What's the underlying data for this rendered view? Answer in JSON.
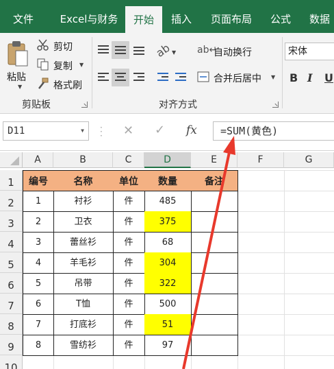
{
  "tabs": [
    "文件",
    "Excel与财务",
    "开始",
    "插入",
    "页面布局",
    "公式",
    "数据"
  ],
  "clipboard": {
    "paste_label": "粘贴",
    "cut_label": "剪切",
    "copy_label": "复制",
    "format_painter_label": "格式刷",
    "group_label": "剪贴板"
  },
  "alignment": {
    "wrap_text_label": "自动换行",
    "merge_center_label": "合并后居中",
    "group_label": "对齐方式"
  },
  "font": {
    "font_name": "宋体",
    "bold": "B",
    "italic": "I",
    "underline": "U"
  },
  "formula_bar": {
    "name_box": "D11",
    "cancel_icon": "✕",
    "enter_icon": "✓",
    "fx_label": "fx",
    "formula": "=SUM(黄色)"
  },
  "columns": [
    "A",
    "B",
    "C",
    "D",
    "E",
    "F",
    "G"
  ],
  "rows": [
    "1",
    "2",
    "3",
    "4",
    "5",
    "6",
    "7",
    "8",
    "9",
    "10"
  ],
  "table": {
    "headers": [
      "编号",
      "名称",
      "单位",
      "数量",
      "备注"
    ],
    "rows": [
      [
        "1",
        "衬衫",
        "件",
        "485",
        ""
      ],
      [
        "2",
        "卫衣",
        "件",
        "375",
        ""
      ],
      [
        "3",
        "蕾丝衫",
        "件",
        "68",
        ""
      ],
      [
        "4",
        "羊毛衫",
        "件",
        "304",
        ""
      ],
      [
        "5",
        "吊带",
        "件",
        "322",
        ""
      ],
      [
        "6",
        "T恤",
        "件",
        "500",
        ""
      ],
      [
        "7",
        "打底衫",
        "件",
        "51",
        ""
      ],
      [
        "8",
        "雪纺衫",
        "件",
        "97",
        ""
      ]
    ],
    "yellow_rows": [
      1,
      3,
      4,
      6
    ]
  },
  "colors": {
    "accent": "#217346",
    "header_fill": "#f4b183",
    "highlight_fill": "#ffff00",
    "arrow": "#e8392c"
  }
}
